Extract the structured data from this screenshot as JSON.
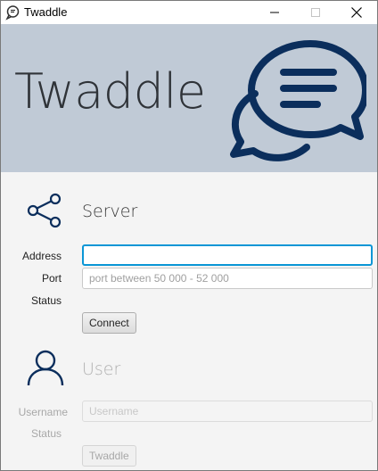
{
  "window": {
    "title": "Twaddle",
    "icon": "chat-bubble-icon"
  },
  "banner": {
    "title": "Twaddle",
    "logo": "chat-bubbles-logo",
    "background": "#c0cad6",
    "logo_color": "#0b2e5c"
  },
  "server": {
    "title": "Server",
    "icon": "share-icon",
    "address_label": "Address",
    "address_value": "",
    "port_label": "Port",
    "port_placeholder": "port between 50 000 - 52 000",
    "status_label": "Status",
    "connect_label": "Connect"
  },
  "user": {
    "title": "User",
    "icon": "user-icon",
    "username_label": "Username",
    "username_placeholder": "Username",
    "status_label": "Status",
    "submit_label": "Twaddle"
  },
  "colors": {
    "accent_focus": "#0a96d6",
    "icon_dark": "#0b2e5c"
  }
}
